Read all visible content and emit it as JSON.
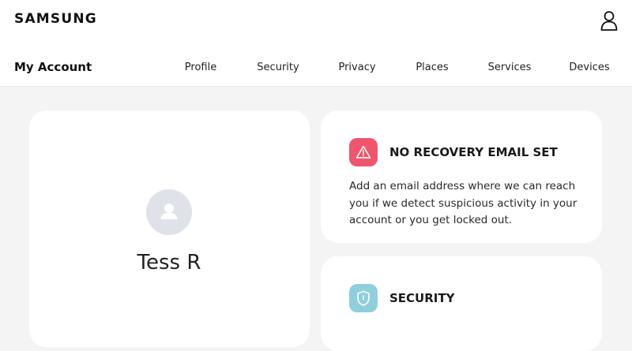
{
  "header": {
    "brand": "SAMSUNG",
    "user_icon": "user-icon"
  },
  "subnav": {
    "title": "My Account",
    "items": [
      {
        "label": "Profile"
      },
      {
        "label": "Security"
      },
      {
        "label": "Privacy"
      },
      {
        "label": "Places"
      },
      {
        "label": "Services"
      },
      {
        "label": "Devices"
      }
    ]
  },
  "profile": {
    "name": "Tess R",
    "avatar_icon": "person-icon"
  },
  "alerts": [
    {
      "icon": "warning-triangle-icon",
      "title": "NO RECOVERY EMAIL SET",
      "body": "Add an email address where we can reach you if we detect suspicious activity in your account or you get locked out.",
      "color": "#f0556e"
    },
    {
      "icon": "shield-icon",
      "title": "SECURITY",
      "color": "#8fcfdc"
    }
  ]
}
